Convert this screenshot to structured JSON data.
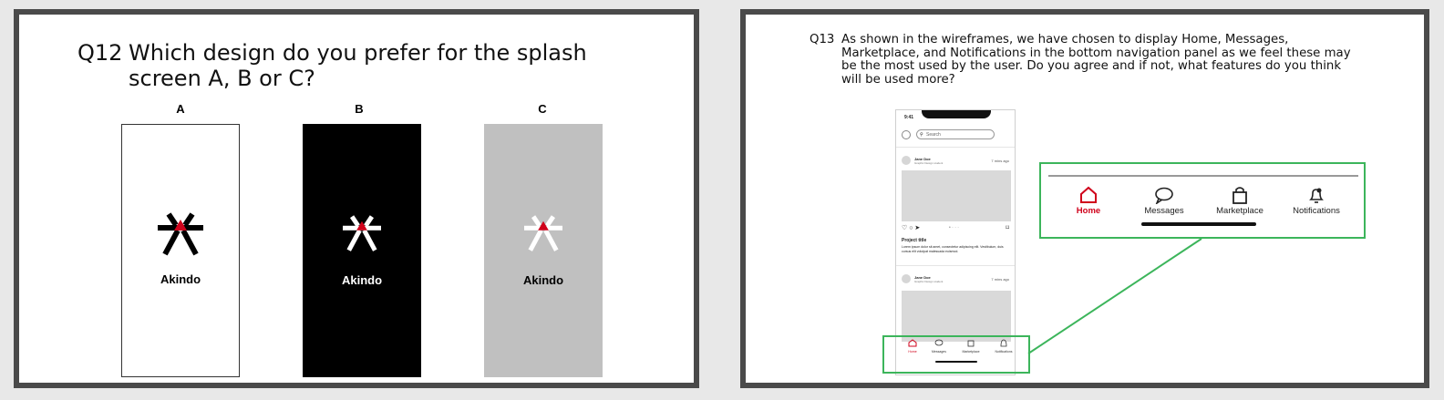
{
  "slide1": {
    "question_number": "Q12",
    "question_text": "Which design do you prefer for the splash screen A, B or C?",
    "options": [
      {
        "label": "A",
        "brand": "Akindo",
        "background": "#ffffff",
        "text_color": "#000000"
      },
      {
        "label": "B",
        "brand": "Akindo",
        "background": "#000000",
        "text_color": "#ffffff"
      },
      {
        "label": "C",
        "brand": "Akindo",
        "background": "#c0c0c0",
        "text_color": "#000000"
      }
    ],
    "accent": "#d0021b"
  },
  "slide2": {
    "question_number": "Q13",
    "question_text": "As shown in the wireframes, we have chosen to display Home, Messages, Marketplace, and Notifications in the bottom navigation panel as we feel these may be the most used by the user. Do you agree and if not, what features do you think will be used more?",
    "phone": {
      "time": "9:41",
      "search_placeholder": "Search",
      "posts": [
        {
          "author": "Jane Doe",
          "subtitle": "Graphic Design student",
          "time_ago": "7 mins ago"
        },
        {
          "author": "Jane Doe",
          "subtitle": "Graphic Design student",
          "time_ago": "7 mins ago"
        }
      ],
      "project_title": "Project title",
      "project_desc": "Lorem ipsum dolor sit amet, consectetur adipiscing elit. Vestibulum, duis cursus elit volutpat malesuada euismod."
    },
    "nav": [
      {
        "label": "Home",
        "icon": "home-icon",
        "active": true
      },
      {
        "label": "Messages",
        "icon": "chat-bubble-icon",
        "active": false
      },
      {
        "label": "Marketplace",
        "icon": "shopping-bag-icon",
        "active": false
      },
      {
        "label": "Notifications",
        "icon": "bell-icon",
        "active": false
      }
    ],
    "active_color": "#d0021b",
    "highlight_color": "#3cb55b"
  }
}
